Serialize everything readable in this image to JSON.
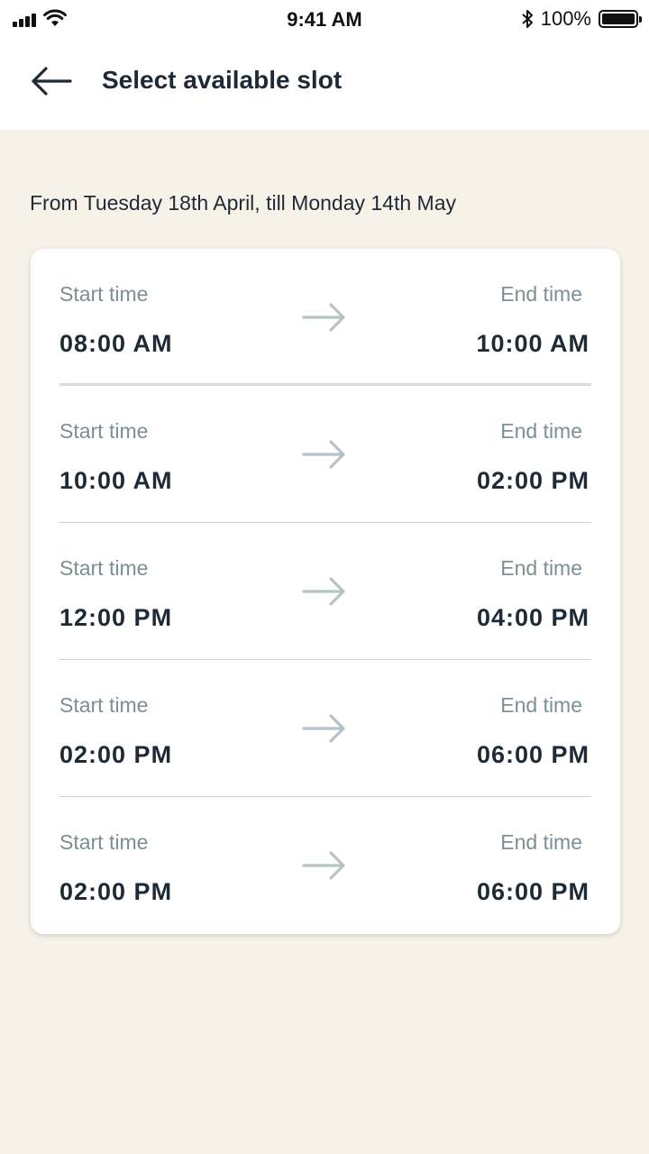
{
  "status_bar": {
    "time": "9:41 AM",
    "battery": "100%"
  },
  "header": {
    "title": "Select available slot"
  },
  "date_range": "From Tuesday 18th April, till Monday 14th May",
  "slots": [
    {
      "start_label": "Start time",
      "start": "08:00 AM",
      "end_label": "End time",
      "end": "10:00 AM"
    },
    {
      "start_label": "Start time",
      "start": "10:00 AM",
      "end_label": "End time",
      "end": "02:00 PM"
    },
    {
      "start_label": "Start time",
      "start": "12:00 PM",
      "end_label": "End time",
      "end": "04:00 PM"
    },
    {
      "start_label": "Start time",
      "start": "02:00 PM",
      "end_label": "End time",
      "end": "06:00 PM"
    },
    {
      "start_label": "Start time",
      "start": "02:00 PM",
      "end_label": "End time",
      "end": "06:00 PM"
    }
  ],
  "colors": {
    "background": "#f6f2e8",
    "card": "#ffffff",
    "label": "#7b8f96",
    "value": "#1f2a37",
    "arrow": "#b5c2c6"
  },
  "icons": {
    "back": "arrow-left-icon",
    "slot_arrow": "arrow-right-icon",
    "signal": "cellular-signal-icon",
    "wifi": "wifi-icon",
    "bluetooth": "bluetooth-icon",
    "battery": "battery-icon"
  }
}
